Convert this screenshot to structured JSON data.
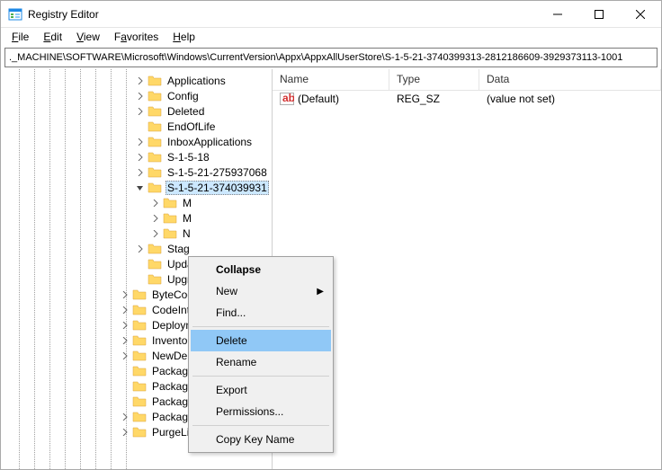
{
  "window": {
    "title": "Registry Editor"
  },
  "menubar": {
    "file": "File",
    "edit": "Edit",
    "view": "View",
    "favorites": "Favorites",
    "help": "Help"
  },
  "address": "._MACHINE\\SOFTWARE\\Microsoft\\Windows\\CurrentVersion\\Appx\\AppxAllUserStore\\S-1-5-21-3740399313-2812186609-3929373113-1001",
  "list": {
    "headers": {
      "name": "Name",
      "type": "Type",
      "data": "Data"
    },
    "rows": [
      {
        "name": "(Default)",
        "type": "REG_SZ",
        "data": "(value not set)"
      }
    ]
  },
  "tree": {
    "items": [
      {
        "depth": 9,
        "exp": ">",
        "label": "Applications"
      },
      {
        "depth": 9,
        "exp": ">",
        "label": "Config"
      },
      {
        "depth": 9,
        "exp": ">",
        "label": "Deleted"
      },
      {
        "depth": 9,
        "exp": "",
        "label": "EndOfLife"
      },
      {
        "depth": 9,
        "exp": ">",
        "label": "InboxApplications"
      },
      {
        "depth": 9,
        "exp": ">",
        "label": "S-1-5-18"
      },
      {
        "depth": 9,
        "exp": ">",
        "label": "S-1-5-21-275937068"
      },
      {
        "depth": 9,
        "exp": "v",
        "label": "S-1-5-21-374039931",
        "selected": true
      },
      {
        "depth": 10,
        "exp": ">",
        "label": "M"
      },
      {
        "depth": 10,
        "exp": ">",
        "label": "M"
      },
      {
        "depth": 10,
        "exp": ">",
        "label": "N"
      },
      {
        "depth": 9,
        "exp": ">",
        "label": "Stag"
      },
      {
        "depth": 9,
        "exp": "",
        "label": "Upda"
      },
      {
        "depth": 9,
        "exp": "",
        "label": "Upgr"
      },
      {
        "depth": 8,
        "exp": ">",
        "label": "ByteCod"
      },
      {
        "depth": 8,
        "exp": ">",
        "label": "CodeInt"
      },
      {
        "depth": 8,
        "exp": ">",
        "label": "Deployn"
      },
      {
        "depth": 8,
        "exp": ">",
        "label": "Invento"
      },
      {
        "depth": 8,
        "exp": ">",
        "label": "NewDep"
      },
      {
        "depth": 8,
        "exp": "",
        "label": "PackageRepair"
      },
      {
        "depth": 8,
        "exp": "",
        "label": "PackageSidRef"
      },
      {
        "depth": 8,
        "exp": "",
        "label": "PackageState"
      },
      {
        "depth": 8,
        "exp": ">",
        "label": "PackageVolumes"
      },
      {
        "depth": 8,
        "exp": ">",
        "label": "PurgeList"
      }
    ]
  },
  "context_menu": {
    "collapse": "Collapse",
    "new": "New",
    "find": "Find...",
    "delete": "Delete",
    "rename": "Rename",
    "export": "Export",
    "permissions": "Permissions...",
    "copy_key": "Copy Key Name"
  }
}
